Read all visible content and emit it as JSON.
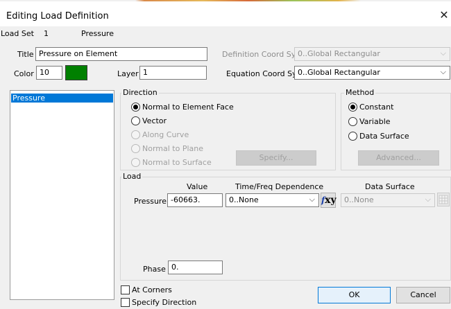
{
  "window": {
    "title": "Editing Load Definition"
  },
  "info": {
    "load_set_label": "Load Set",
    "load_set_value": "1",
    "load_type": "Pressure"
  },
  "fields": {
    "title_label": "Title",
    "title_value": "Pressure on Element",
    "definition_coord_label": "Definition Coord Sys",
    "definition_coord_value": "0..Global Rectangular",
    "color_label": "Color",
    "color_value": "10",
    "color_swatch": "#008000",
    "layer_label": "Layer",
    "layer_value": "1",
    "equation_coord_label": "Equation Coord Sys",
    "equation_coord_value": "0..Global Rectangular"
  },
  "load_list": {
    "items": [
      "Pressure"
    ]
  },
  "direction": {
    "label": "Direction",
    "options": [
      {
        "label": "Normal to Element Face",
        "checked": true,
        "enabled": true
      },
      {
        "label": "Vector",
        "checked": false,
        "enabled": true
      },
      {
        "label": "Along Curve",
        "checked": false,
        "enabled": false
      },
      {
        "label": "Normal to Plane",
        "checked": false,
        "enabled": false
      },
      {
        "label": "Normal to Surface",
        "checked": false,
        "enabled": false
      }
    ],
    "specify_label": "Specify..."
  },
  "method": {
    "label": "Method",
    "options": [
      {
        "label": "Constant",
        "checked": true
      },
      {
        "label": "Variable",
        "checked": false
      },
      {
        "label": "Data Surface",
        "checked": false
      }
    ],
    "advanced_label": "Advanced..."
  },
  "load": {
    "label": "Load",
    "value_header": "Value",
    "time_header": "Time/Freq Dependence",
    "data_surface_header": "Data Surface",
    "pressure_label": "Pressure",
    "pressure_value": "-60663.",
    "time_value": "0..None",
    "data_surface_value": "0..None",
    "fxy_text": "xy",
    "fxy_f": "f",
    "phase_label": "Phase",
    "phase_value": "0."
  },
  "options": {
    "at_corners": "At Corners",
    "specify_direction": "Specify Direction"
  },
  "buttons": {
    "ok": "OK",
    "cancel": "Cancel"
  },
  "colors": {
    "selection": "#0078d7",
    "dialog_bg": "#f0f0f0"
  }
}
